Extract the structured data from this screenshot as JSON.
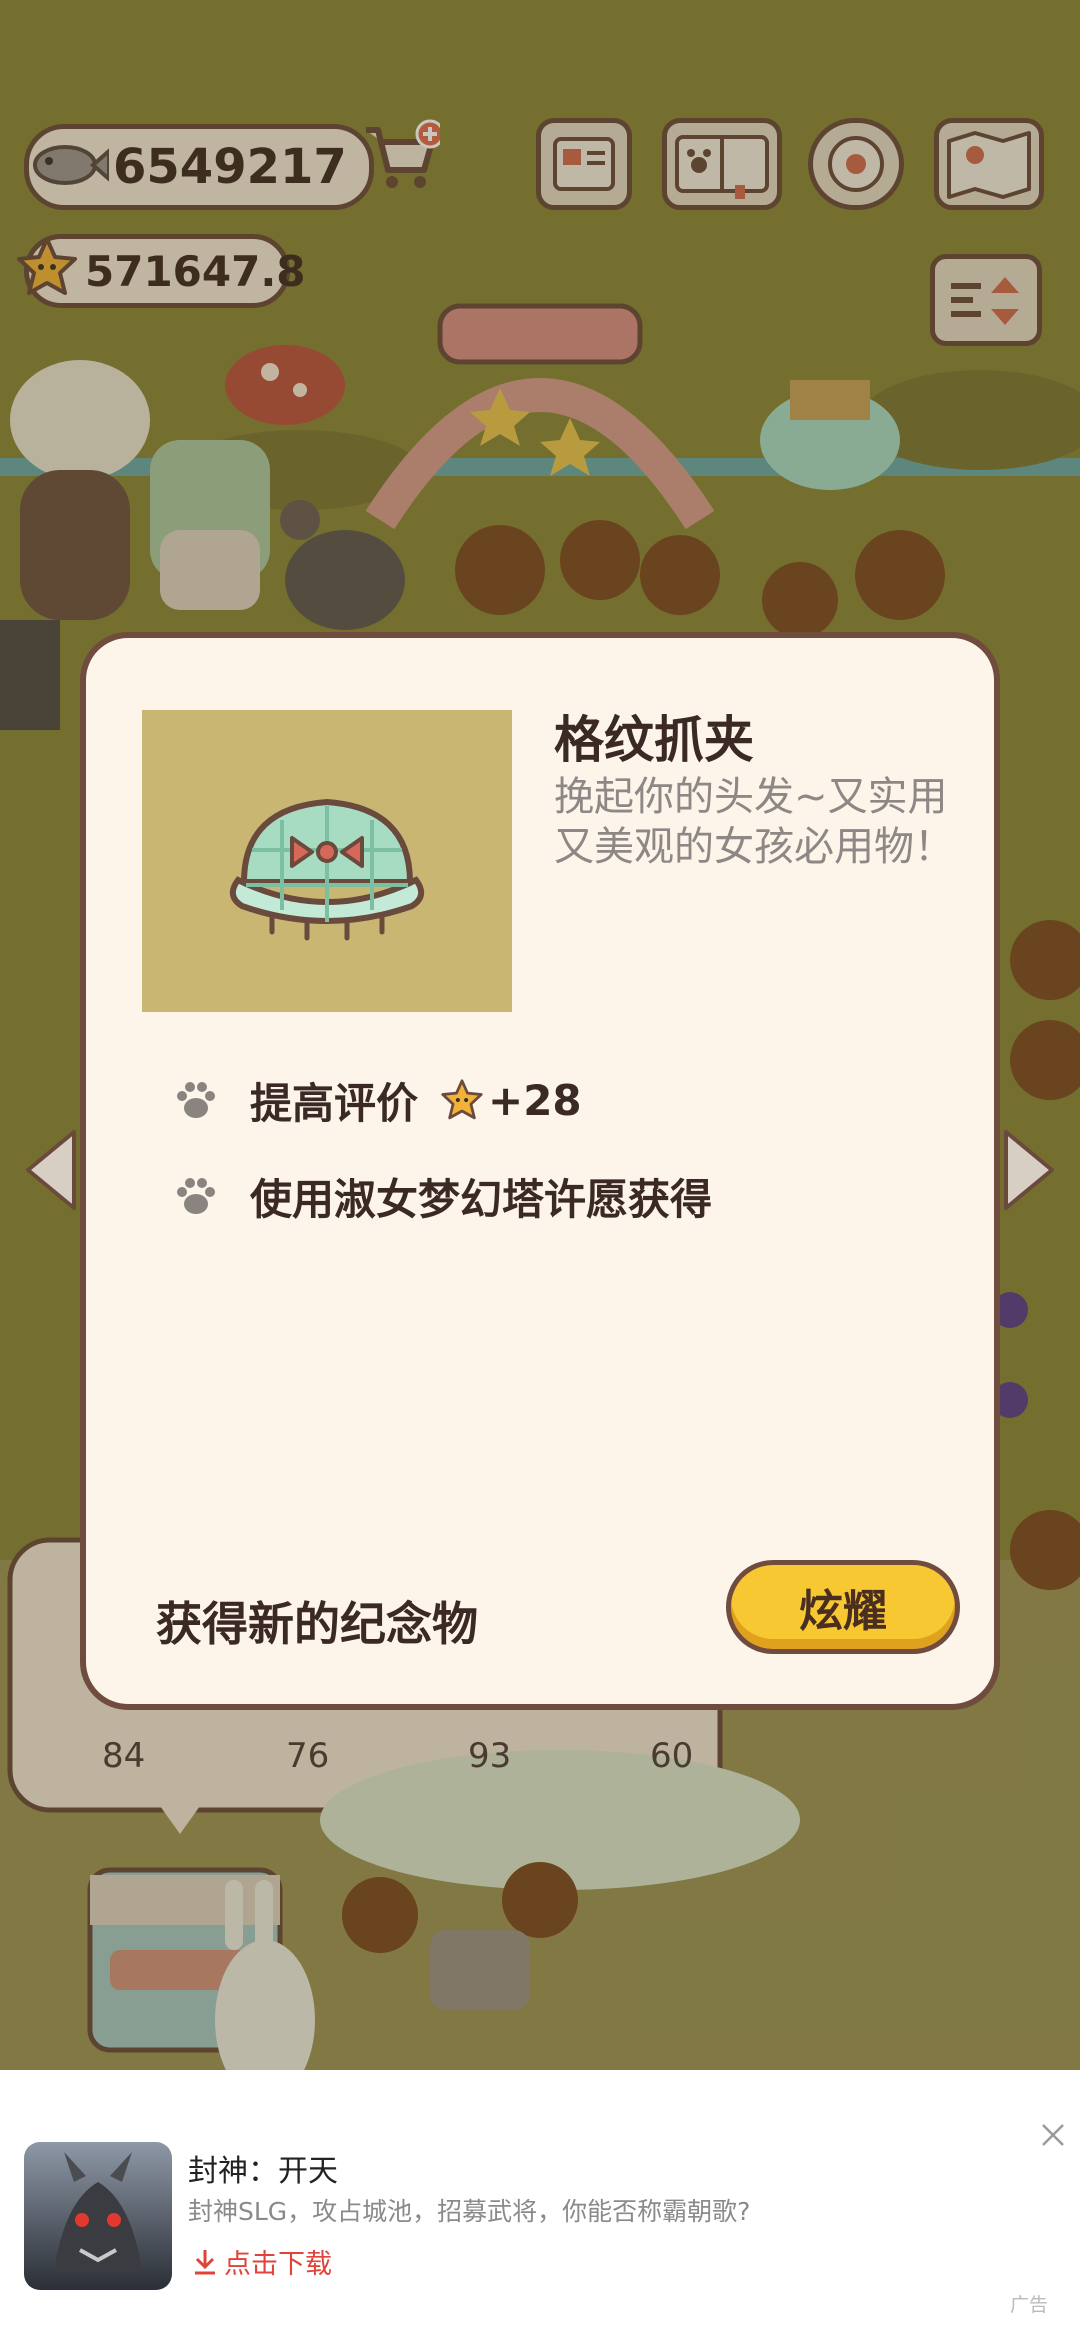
{
  "hud": {
    "fish_count": "6549217",
    "star_count": "571647.8"
  },
  "dialog": {
    "item_title": "格纹抓夹",
    "item_desc": "挽起你的头发~又实用又美观的女孩必用物！",
    "attr_rating_label": "提高评价",
    "attr_rating_value": "+28",
    "attr_source": "使用淑女梦幻塔许愿获得",
    "footer_text": "获得新的纪念物",
    "button_label": "炫耀"
  },
  "counts": [
    "84",
    "76",
    "93",
    "60"
  ],
  "ad": {
    "title": "封神：开天",
    "description": "封神SLG，攻占城池，招募武将，你能否称霸朝歌?",
    "download_label": "点击下载",
    "ad_label": "广告"
  },
  "colors": {
    "button": "#f8c832",
    "dialog_bg": "#fdf4ea",
    "border": "#6f4c3e",
    "download_text": "#e0433a"
  }
}
